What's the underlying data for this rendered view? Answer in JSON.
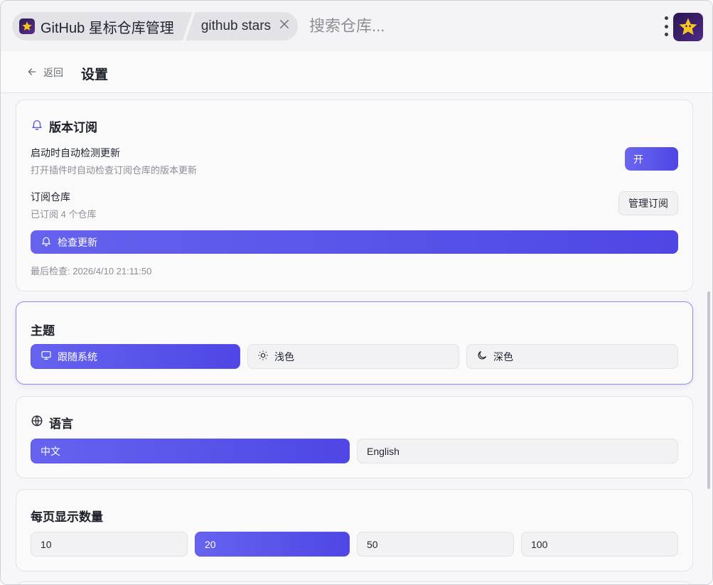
{
  "topbar": {
    "app_chip_label": "GitHub 星标仓库管理",
    "query_chip_label": "github stars",
    "search_placeholder": "搜索仓库..."
  },
  "header": {
    "back_label": "返回",
    "title": "设置"
  },
  "subscription": {
    "title": "版本订阅",
    "auto_check_title": "启动时自动检测更新",
    "auto_check_desc": "打开插件时自动检查订阅仓库的版本更新",
    "auto_check_toggle": "开",
    "repos_title": "订阅仓库",
    "repos_desc": "已订阅 4 个仓库",
    "manage_label": "管理订阅",
    "check_button": "检查更新",
    "last_check": "最后检查: 2026/4/10 21:11:50"
  },
  "theme": {
    "title": "主题",
    "options": [
      "跟随系统",
      "浅色",
      "深色"
    ],
    "selected": "跟随系统"
  },
  "language": {
    "title": "语言",
    "options": [
      "中文",
      "English"
    ],
    "selected": "中文"
  },
  "page_size": {
    "title": "每页显示数量",
    "options": [
      "10",
      "20",
      "50",
      "100"
    ],
    "selected": "20"
  },
  "colors": {
    "accent": "#4f46e5",
    "accent_light": "#6663ef"
  }
}
